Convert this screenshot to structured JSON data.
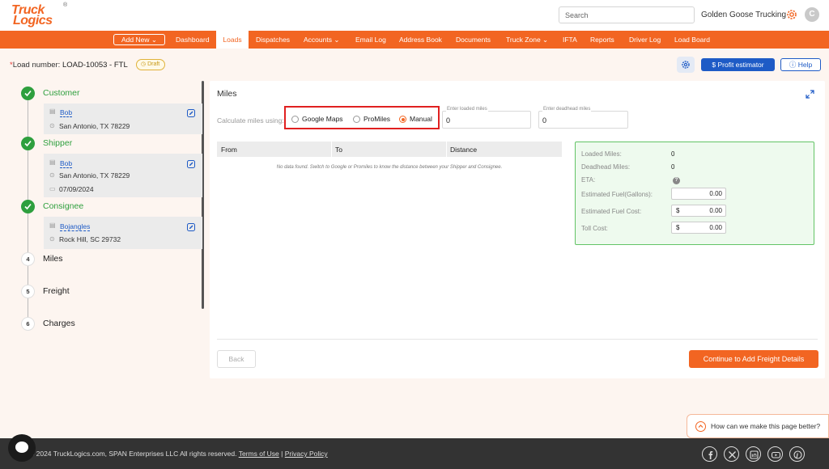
{
  "header": {
    "logo_line1": "Truck",
    "logo_line2": "Logics",
    "logo_reg": "®",
    "search_placeholder": "Search",
    "company": "Golden Goose Trucking",
    "avatar_letter": "C"
  },
  "nav": {
    "add_new": "Add New ⌄",
    "items": [
      "Dashboard",
      "Loads",
      "Dispatches",
      "Accounts ⌄",
      "Email Log",
      "Address Book",
      "Documents",
      "Truck Zone ⌄",
      "IFTA",
      "Reports",
      "Driver Log",
      "Load Board"
    ],
    "active": "Loads"
  },
  "subheader": {
    "load_prefix": "*",
    "load_label": "Load number: ",
    "load_value": "LOAD-10053 - FTL",
    "draft": "Draft",
    "profit_estimator": "$  Profit estimator",
    "help": "Help"
  },
  "steps": {
    "customer": {
      "title": "Customer",
      "name": "Bob",
      "address": "San Antonio, TX 78229"
    },
    "shipper": {
      "title": "Shipper",
      "name": "Bob",
      "address": "San Antonio, TX 78229",
      "date": "07/09/2024"
    },
    "consignee": {
      "title": "Consignee",
      "name": "Bojangles",
      "address": "Rock Hill, SC 29732"
    },
    "miles": {
      "num": "4",
      "title": "Miles"
    },
    "freight": {
      "num": "5",
      "title": "Freight"
    },
    "charges": {
      "num": "6",
      "title": "Charges"
    }
  },
  "miles_panel": {
    "title": "Miles",
    "calc_label": "Calculate miles using:",
    "options": [
      "Google Maps",
      "ProMiles",
      "Manual"
    ],
    "selected": "Manual",
    "loaded_label": "Enter loaded miles",
    "loaded_value": "0",
    "deadhead_label": "Enter deadhead miles",
    "deadhead_value": "0",
    "table_headers": [
      "From",
      "To",
      "Distance"
    ],
    "no_data": "No data found. Switch to Google or Promiles to know the distance between your Shipper and Consignee.",
    "summary": {
      "loaded_miles_label": "Loaded Miles:",
      "loaded_miles": "0",
      "deadhead_miles_label": "Deadhead Miles:",
      "deadhead_miles": "0",
      "eta_label": "ETA:",
      "fuel_gallons_label": "Estimated Fuel(Gallons):",
      "fuel_gallons": "0.00",
      "fuel_cost_label": "Estimated Fuel Cost:",
      "fuel_cost": "0.00",
      "toll_cost_label": "Toll Cost:",
      "toll_cost": "0.00",
      "currency": "$"
    },
    "back": "Back",
    "continue": "Continue to Add Freight Details"
  },
  "feedback": "How can we make this page better?",
  "footer": {
    "copyright": "© 2024 TruckLogics.com, SPAN Enterprises LLC All rights reserved.",
    "terms": "Terms of Use",
    "sep": "|",
    "privacy": "Privacy Policy"
  },
  "colors": {
    "brand": "#f26522",
    "primary_blue": "#1e5bc6",
    "success_green": "#2e9f3e"
  }
}
